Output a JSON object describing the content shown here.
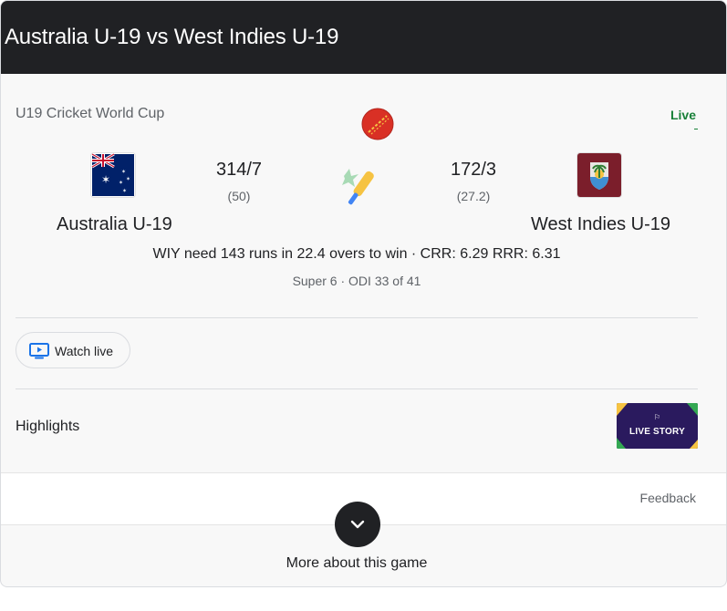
{
  "header": {
    "title": "Australia U-19 vs West Indies U-19"
  },
  "match": {
    "tournament": "U19 Cricket World Cup",
    "live_label": "Live",
    "team_a": {
      "name": "Australia U-19",
      "score": "314/7",
      "overs": "(50)"
    },
    "team_b": {
      "name": "West Indies U-19",
      "score": "172/3",
      "overs": "(27.2)"
    },
    "status": "WIY need 143 runs in 22.4 overs to win · CRR: 6.29 RRR: 6.31",
    "series": "Super 6 · ODI 33 of 41"
  },
  "actions": {
    "watch_live_label": "Watch live"
  },
  "highlights": {
    "label": "Highlights",
    "thumbnail_text": "LIVE STORY"
  },
  "footer": {
    "feedback_label": "Feedback",
    "more_label": "More about this game"
  },
  "icons": {
    "ball": "cricket-ball-icon",
    "bat": "cricket-bat-icon",
    "tv": "tv-play-icon",
    "chevron": "chevron-down-icon"
  },
  "colors": {
    "header_bg": "#202124",
    "live": "#188038",
    "link_blue": "#1a73e8"
  }
}
